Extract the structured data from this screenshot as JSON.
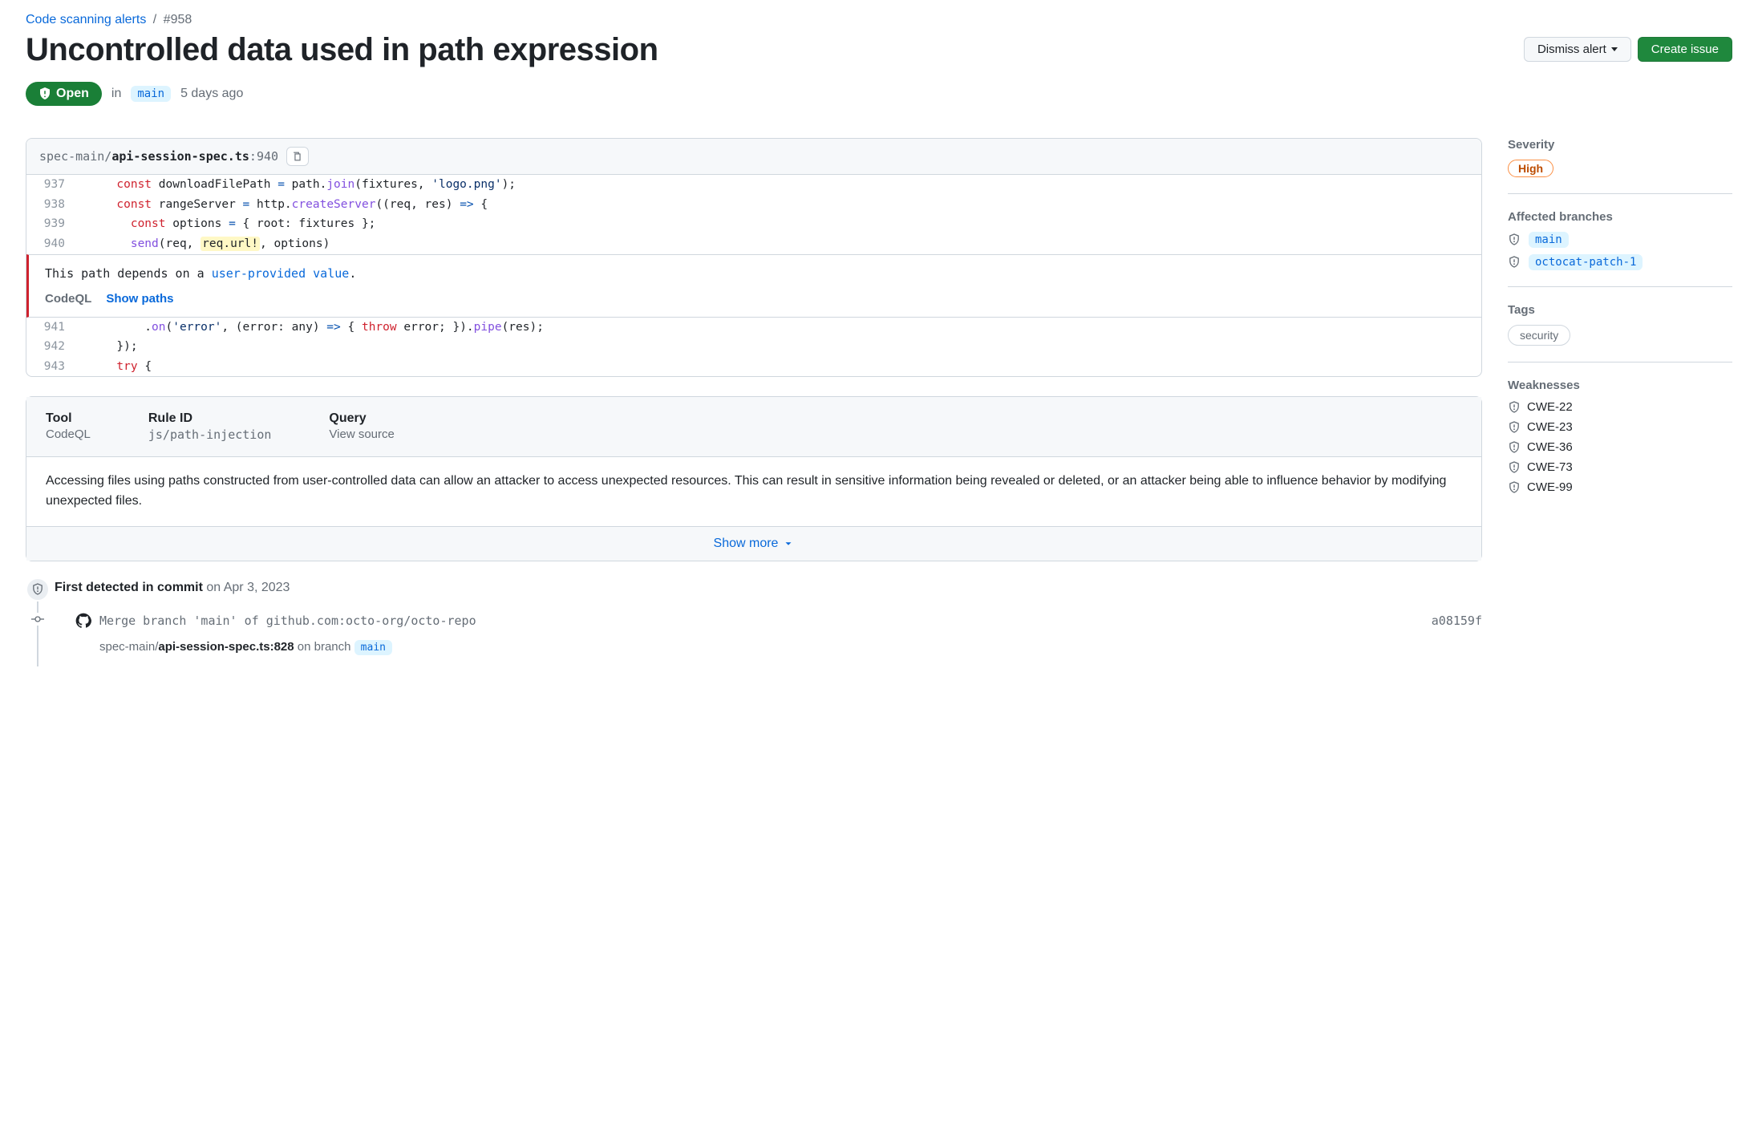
{
  "breadcrumb": {
    "parent": "Code scanning alerts",
    "number": "#958"
  },
  "title": "Uncontrolled data used in path expression",
  "actions": {
    "dismiss": "Dismiss alert",
    "create_issue": "Create issue"
  },
  "status": {
    "state": "Open",
    "in_label": "in",
    "branch": "main",
    "time": "5 days ago"
  },
  "file": {
    "dir": "spec-main/",
    "name": "api-session-spec.ts",
    "line": "940"
  },
  "code_lines_before": [
    {
      "n": "937",
      "html": "      <span class=\"tok-kw\">const</span> downloadFilePath <span class=\"tok-op\">=</span> path.<span class=\"tok-fn\">join</span>(fixtures, <span class=\"tok-str\">'logo.png'</span>);"
    },
    {
      "n": "938",
      "html": "      <span class=\"tok-kw\">const</span> rangeServer <span class=\"tok-op\">=</span> http.<span class=\"tok-fn\">createServer</span>((req, res) <span class=\"tok-op\">=&gt;</span> {"
    },
    {
      "n": "939",
      "html": "        <span class=\"tok-kw\">const</span> options <span class=\"tok-op\">=</span> { root: fixtures };"
    },
    {
      "n": "940",
      "html": "        <span class=\"tok-fn\">send</span>(req, <span class=\"hl\">req.url!</span>, options)"
    }
  ],
  "annotation": {
    "text_prefix": "This path depends on a ",
    "link_text": "user-provided value",
    "text_suffix": ".",
    "tool": "CodeQL",
    "show_paths": "Show paths"
  },
  "code_lines_after": [
    {
      "n": "941",
      "html": "          .<span class=\"tok-fn\">on</span>(<span class=\"tok-str\">'error'</span>, (error: any) <span class=\"tok-op\">=&gt;</span> { <span class=\"tok-kw\">throw</span> error; }).<span class=\"tok-fn\">pipe</span>(res);"
    },
    {
      "n": "942",
      "html": "      });"
    },
    {
      "n": "943",
      "html": "      <span class=\"tok-kw\">try</span> {"
    }
  ],
  "details": {
    "tool_h": "Tool",
    "tool_v": "CodeQL",
    "rule_h": "Rule ID",
    "rule_v": "js/path-injection",
    "query_h": "Query",
    "query_v": "View source",
    "description": "Accessing files using paths constructed from user-controlled data can allow an attacker to access unexpected resources. This can result in sensitive information being revealed or deleted, or an attacker being able to influence behavior by modifying unexpected files.",
    "show_more": "Show more"
  },
  "timeline": {
    "first_detected": "First detected in commit",
    "first_detected_date": " on Apr 3, 2023",
    "commit_msg": "Merge branch 'main' of github.com:octo-org/octo-repo",
    "commit_sha": "a08159f",
    "file_dir": "spec-main/",
    "file_name": "api-session-spec.ts:828",
    "on_branch": " on branch ",
    "branch": "main"
  },
  "sidebar": {
    "severity_h": "Severity",
    "severity": "High",
    "branches_h": "Affected branches",
    "branches": [
      "main",
      "octocat-patch-1"
    ],
    "tags_h": "Tags",
    "tags": [
      "security"
    ],
    "weaknesses_h": "Weaknesses",
    "weaknesses": [
      "CWE-22",
      "CWE-23",
      "CWE-36",
      "CWE-73",
      "CWE-99"
    ]
  }
}
